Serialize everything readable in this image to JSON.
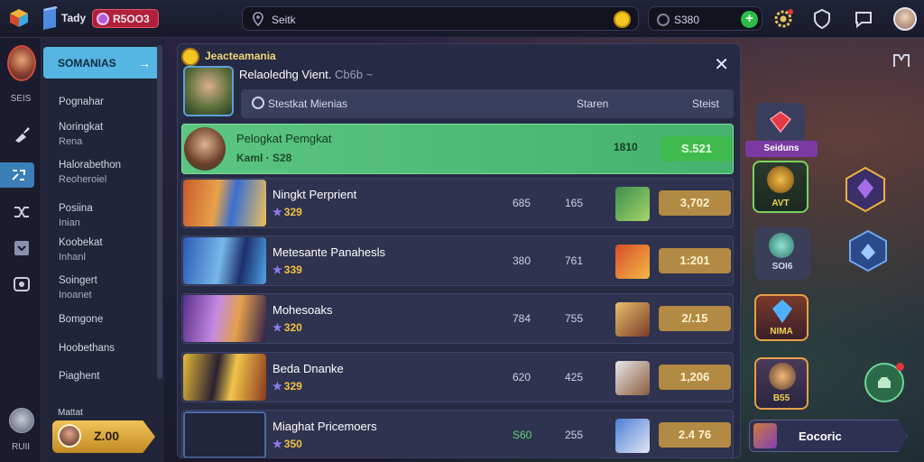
{
  "topbar": {
    "title": "Tady",
    "gems": "R5OO3",
    "search_text": "Seitk",
    "currency": "S380"
  },
  "sidebar": {
    "label_top": "SEIS",
    "label_bottom": "RUII"
  },
  "nav": {
    "header": "SOMANIAS",
    "items": [
      {
        "title": "Pognahar",
        "sub": ""
      },
      {
        "title": "Noringkat",
        "sub": "Rena"
      },
      {
        "title": "Halorabethon",
        "sub": "Reoheroiel"
      },
      {
        "title": "Posiina",
        "sub": "Inian"
      },
      {
        "title": "Koobekat",
        "sub": "Inhanl"
      },
      {
        "title": "Soingert",
        "sub": "Inoanet"
      },
      {
        "title": "Bomgone",
        "sub": ""
      },
      {
        "title": "Hoobethans",
        "sub": ""
      },
      {
        "title": "Piaghent",
        "sub": ""
      }
    ],
    "footer_label": "Mattat",
    "footer_value": "Z.00"
  },
  "panel": {
    "title": "Jeacteamania",
    "subtitle": "Relaoledhg Vient.",
    "subtitle_meta": "Cb6b ~",
    "columns": [
      "Stestkat Mienias",
      "Staren",
      "Steist"
    ],
    "rows": [
      {
        "name": "Pelogkat Pemgkat",
        "level": "Kaml · S28",
        "v1": "",
        "v2": "1810",
        "value": "S.521"
      },
      {
        "name": "Ningkt Perprient",
        "level": "329",
        "v1": "685",
        "v2": "165",
        "value": "3,702"
      },
      {
        "name": "Metesante Panahesls",
        "level": "339",
        "v1": "380",
        "v2": "761",
        "value": "1:201"
      },
      {
        "name": "Mohesoaks",
        "level": "320",
        "v1": "784",
        "v2": "755",
        "value": "2/.15"
      },
      {
        "name": "Beda Dnanke",
        "level": "329",
        "v1": "620",
        "v2": "425",
        "value": "1,206"
      },
      {
        "name": "Miaghat Pricemoers",
        "level": "350",
        "v1": "S60",
        "v2": "255",
        "value": "2.4 76"
      }
    ]
  },
  "right": {
    "banner": "Seiduns",
    "hero_label": "AVT",
    "orb_label": "SOI6",
    "card_label": "NIMA",
    "card2_label": "B55",
    "footer": "Eocoric"
  },
  "colors": {
    "accent": "#55b5e3",
    "highlight_row": "#5bc581",
    "value_pill": "#b28a43",
    "gold": "#f3c623",
    "gems": "#b0203a"
  }
}
